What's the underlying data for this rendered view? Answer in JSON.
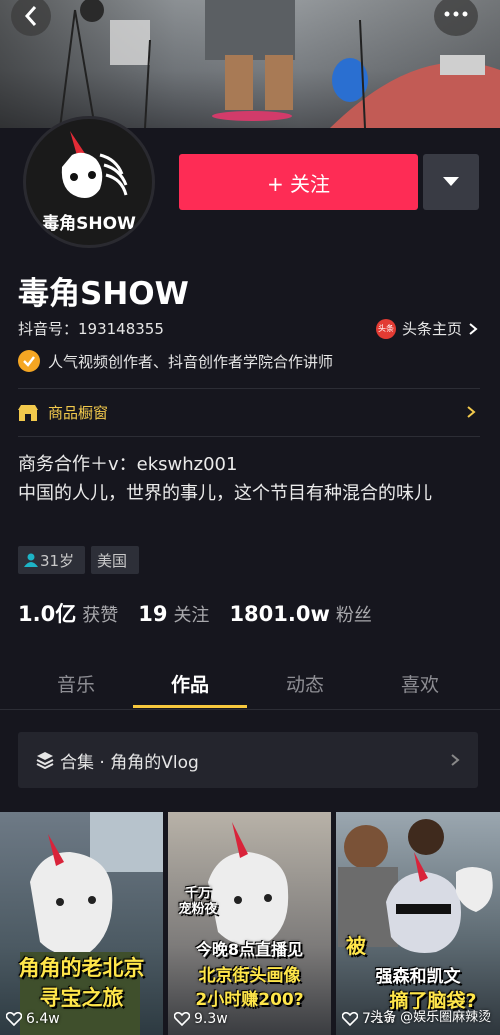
{
  "profile": {
    "nickname": "毒角SHOW",
    "avatar_text": "毒角SHOW",
    "douyin_id": "抖音号：193148355",
    "toutiao_badge": "头条",
    "toutiao_link": "头条主页",
    "certification": "人气视频创作者、抖音创作者学院合作讲师",
    "shop_label": "商品橱窗",
    "bio_line1": "商务合作＋v：ekswhz001",
    "bio_line2": "中国的人儿，世界的事儿，这个节目有种混合的味儿",
    "tags": [
      "31岁",
      "美国"
    ],
    "stats": [
      {
        "value": "1.0亿",
        "label": "获赞"
      },
      {
        "value": "19",
        "label": "关注"
      },
      {
        "value": "1801.0w",
        "label": "粉丝"
      }
    ]
  },
  "actions": {
    "follow_label": "+ 关注"
  },
  "tabs": [
    "音乐",
    "作品",
    "动态",
    "喜欢"
  ],
  "active_tab": "作品",
  "collection_label": "合集 · 角角的Vlog",
  "videos": [
    {
      "cap_top": "",
      "cap_main": "角角的老北京",
      "cap_sub": "寻宝之旅",
      "likes": "6.4w"
    },
    {
      "cap_top": "千万\n宠粉夜",
      "cap_main": "今晚8点直播见",
      "cap_sub": "北京街头画像\n2小时赚200?",
      "likes": "9.3w"
    },
    {
      "cap_top": "被",
      "cap_main": "强森和凯文",
      "cap_sub": "摘了脑袋?",
      "likes": "7.1w"
    }
  ],
  "watermark": "头条 @娱乐圈麻辣烫",
  "colors": {
    "accent": "#fe2c55",
    "highlight": "#f7c83d",
    "background": "#16161e"
  }
}
